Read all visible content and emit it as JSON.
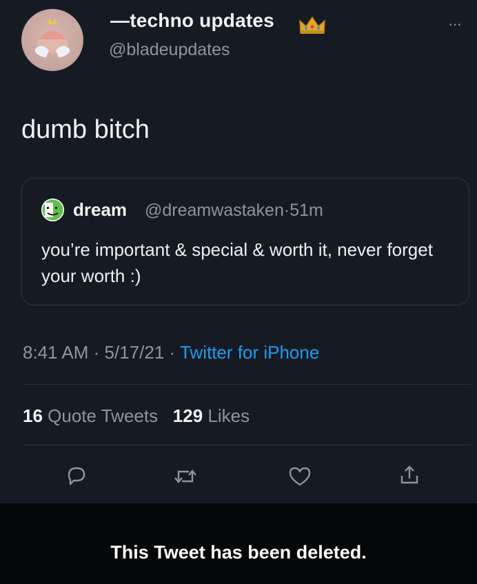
{
  "tweet": {
    "display_name": "—techno updates",
    "handle": "@bladeupdates",
    "more_label": "···",
    "crown_icon": "crown-icon",
    "text": "dumb bitch",
    "quote": {
      "name": "dream",
      "handle": "@dreamwastaken",
      "separator": "·",
      "age": "51m",
      "text": "you’re important & special & worth it, never forget your worth :)"
    },
    "time": "8:41 AM",
    "date": "5/17/21",
    "source": "Twitter for iPhone",
    "quote_tweets_count": "16",
    "quote_tweets_label": "Quote Tweets",
    "likes_count": "129",
    "likes_label": "Likes",
    "action_icons": [
      "reply-icon",
      "retweet-icon",
      "like-icon",
      "share-icon"
    ]
  },
  "notice": {
    "deleted_text": "This Tweet has been deleted."
  },
  "colors": {
    "background": "#161b23",
    "link_blue": "#1d9bf0",
    "secondary_text": "#8a96a3",
    "deleted_bar": "#050608"
  }
}
